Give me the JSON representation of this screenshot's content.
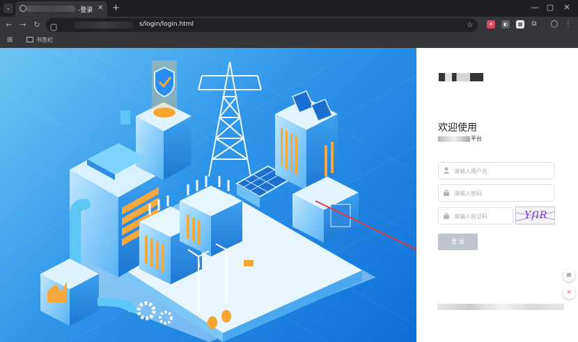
{
  "browser": {
    "tab": {
      "title_suffix": "-登录",
      "close": "✕"
    },
    "tab_menu": "⌄",
    "new_tab": "+",
    "window_controls": [
      "—",
      "▢",
      "✕"
    ],
    "url_text": "s/login/login.html",
    "bookmarks_bar": {
      "folder_label": "书签栏"
    }
  },
  "login": {
    "welcome": "欢迎使用",
    "subtitle_suffix": "平台",
    "username_placeholder": "请输入用户名",
    "password_placeholder": "请输入密码",
    "captcha_placeholder": "请输入验证码",
    "captcha_text": "YflR",
    "login_button": "登 录"
  },
  "colors": {
    "hero_gradient_start": "#6ec5f3",
    "hero_gradient_end": "#0d6fd8",
    "annotation_arrow": "#e53935",
    "button_disabled": "#c0c4cc",
    "captcha_text": "#7b2fd0"
  }
}
